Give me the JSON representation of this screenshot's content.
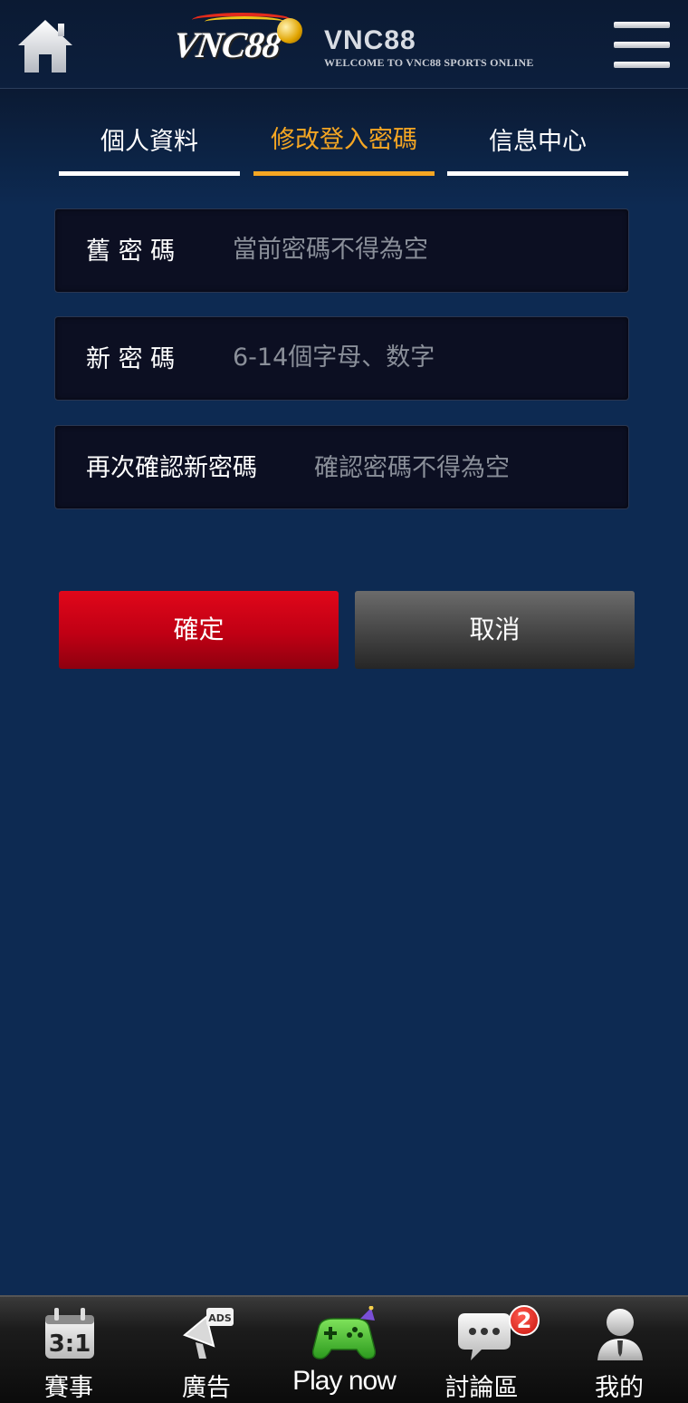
{
  "header": {
    "logo_text": "VNC88",
    "brand_title": "VNC88",
    "brand_subtitle": "WELCOME TO VNC88 SPORTS ONLINE"
  },
  "tabs": [
    {
      "label": "個人資料",
      "active": false
    },
    {
      "label": "修改登入密碼",
      "active": true
    },
    {
      "label": "信息中心",
      "active": false
    }
  ],
  "form": {
    "old_password": {
      "label": "舊 密 碼",
      "placeholder": "當前密碼不得為空"
    },
    "new_password": {
      "label": "新 密 碼",
      "placeholder": "6-14個字母、数字"
    },
    "confirm_password": {
      "label": "再次確認新密碼",
      "placeholder": "確認密碼不得為空"
    }
  },
  "buttons": {
    "confirm": "確定",
    "cancel": "取消"
  },
  "bottom_nav": [
    {
      "label": "賽事",
      "icon": "calendar-score-icon",
      "icon_text": "3:1"
    },
    {
      "label": "廣告",
      "icon": "ads-megaphone-icon",
      "icon_text": "ADS"
    },
    {
      "label": "Play now",
      "icon": "gamepad-icon"
    },
    {
      "label": "討論區",
      "icon": "chat-bubble-icon",
      "badge": "2"
    },
    {
      "label": "我的",
      "icon": "user-profile-icon"
    }
  ],
  "colors": {
    "accent": "#f5a623",
    "background": "#0d2a52",
    "confirm": "#d3001a",
    "cancel": "#4a4a4a"
  }
}
